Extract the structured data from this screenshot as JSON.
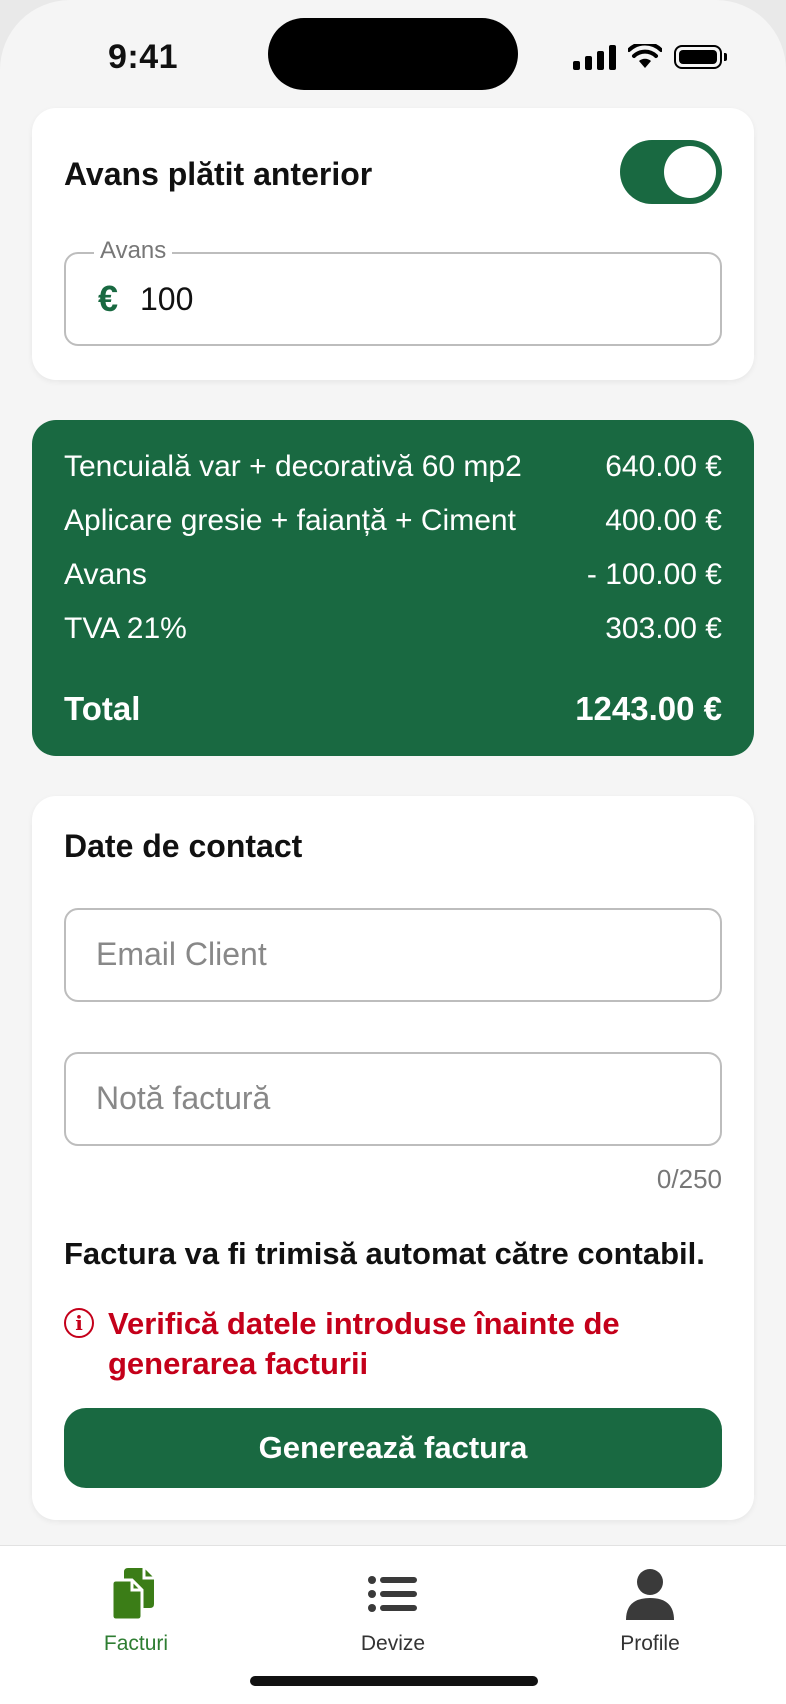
{
  "status_bar": {
    "time": "9:41"
  },
  "advance_card": {
    "title": "Avans plătit anterior",
    "toggle_on": true,
    "field_label": "Avans",
    "currency_symbol": "€",
    "value": "100"
  },
  "summary": {
    "lines": [
      {
        "label": "Tencuială var + decorativă 60 mp2",
        "amount": "640.00 €"
      },
      {
        "label": "Aplicare gresie + faianță + Ciment",
        "amount": "400.00 €"
      },
      {
        "label": "Avans",
        "amount": "- 100.00 €"
      },
      {
        "label": "TVA 21%",
        "amount": "303.00 €"
      }
    ],
    "total_label": "Total",
    "total_amount": "1243.00 €"
  },
  "contact": {
    "title": "Date de contact",
    "email_placeholder": "Email Client",
    "note_placeholder": "Notă factură",
    "counter": "0/250",
    "notice": "Factura va fi trimisă automat către contabil.",
    "warning": "Verifică datele introduse înainte de generarea facturii",
    "button_label": "Generează factura"
  },
  "tabbar": {
    "items": [
      {
        "label": "Facturi",
        "icon": "documents-icon",
        "active": true
      },
      {
        "label": "Devize",
        "icon": "list-icon",
        "active": false
      },
      {
        "label": "Profile",
        "icon": "person-icon",
        "active": false
      }
    ]
  },
  "colors": {
    "brand": "#196941",
    "warning": "#c4001a",
    "tab_active": "#2e7d32"
  }
}
